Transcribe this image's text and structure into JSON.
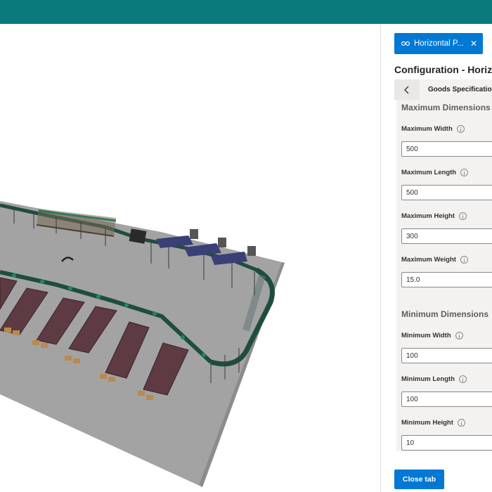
{
  "panel": {
    "tab_label": "Horizontal P...",
    "title": "Configuration - Horizo",
    "subnav_label": "Goods Specification"
  },
  "max_section": {
    "heading": "Maximum Dimensions",
    "fields": [
      {
        "label": "Maximum Width",
        "value": "500"
      },
      {
        "label": "Maximum Length",
        "value": "500"
      },
      {
        "label": "Maximum Height",
        "value": "300"
      },
      {
        "label": "Maximum Weight",
        "value": "15.0"
      }
    ]
  },
  "min_section": {
    "heading": "Minimum Dimensions",
    "fields": [
      {
        "label": "Minimum Width",
        "value": "100"
      },
      {
        "label": "Minimum Length",
        "value": "100"
      },
      {
        "label": "Minimum Height",
        "value": "10"
      }
    ]
  },
  "footer": {
    "close_label": "Close tab"
  },
  "colors": {
    "topbar": "#0b7a7d",
    "accent": "#0078d4",
    "floor": "#a3a3a3",
    "conveyor": "#1e4d3f",
    "lane": "#5e3a42"
  },
  "icons": {
    "tab_icon": "connector-icon",
    "close": "close-icon",
    "back": "chevron-left-icon",
    "info": "info-icon"
  }
}
